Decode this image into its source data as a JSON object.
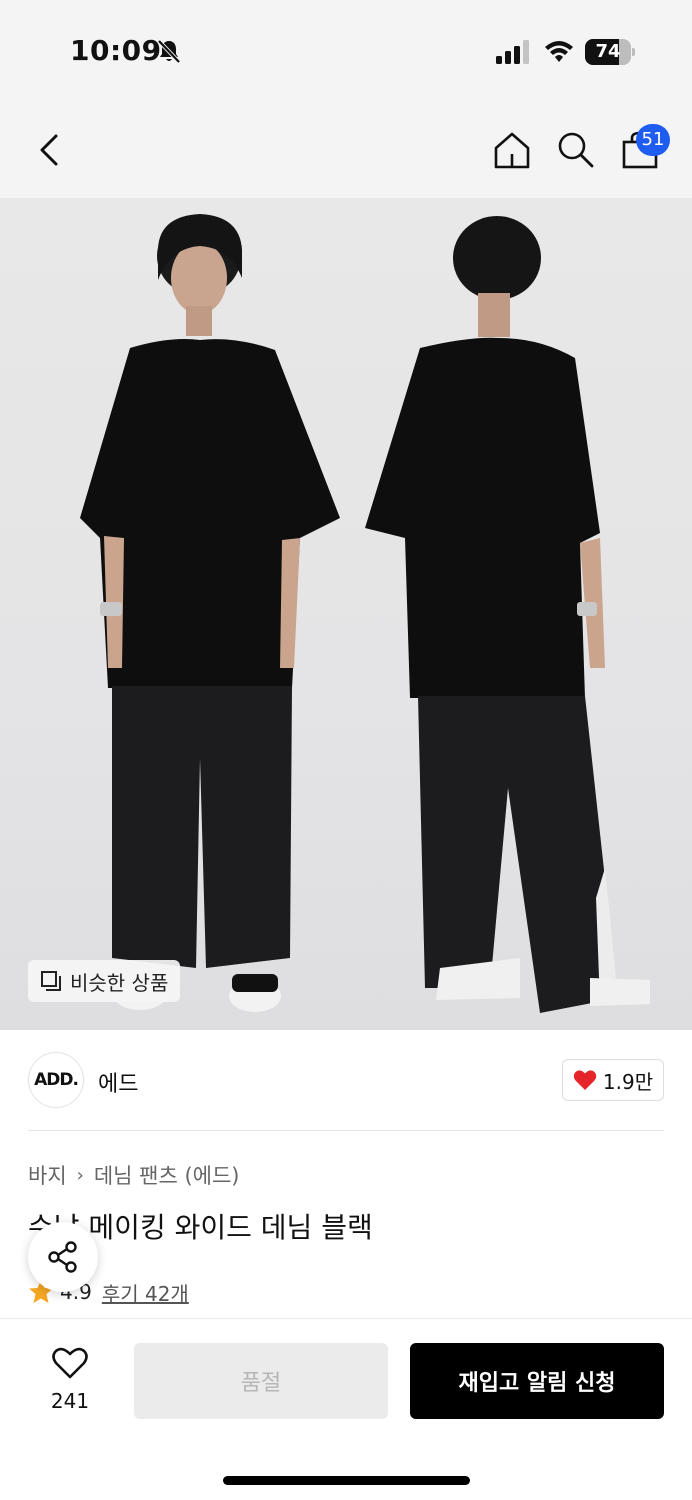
{
  "status_bar": {
    "time": "10:09",
    "battery_percent": 74,
    "battery_label": "74"
  },
  "nav": {
    "cart_count": "51"
  },
  "product_image": {
    "similar_label": "비슷한 상품"
  },
  "brand": {
    "logo_text": "ADD.",
    "name": "에드",
    "likes": "1.9만"
  },
  "breadcrumb": {
    "category": "바지",
    "subcategory": "데님 팬츠 (에드)"
  },
  "product": {
    "title": "수납 메이킹 와이드 데님 블랙",
    "rating": "4.9",
    "review_link": "후기 42개"
  },
  "bottom_bar": {
    "wish_count": "241",
    "soldout_label": "품절",
    "restock_label": "재입고 알림 신청"
  },
  "colors": {
    "accent_blue": "#1f5cf0",
    "heart_red": "#e5252a",
    "star_orange": "#f5a623"
  }
}
